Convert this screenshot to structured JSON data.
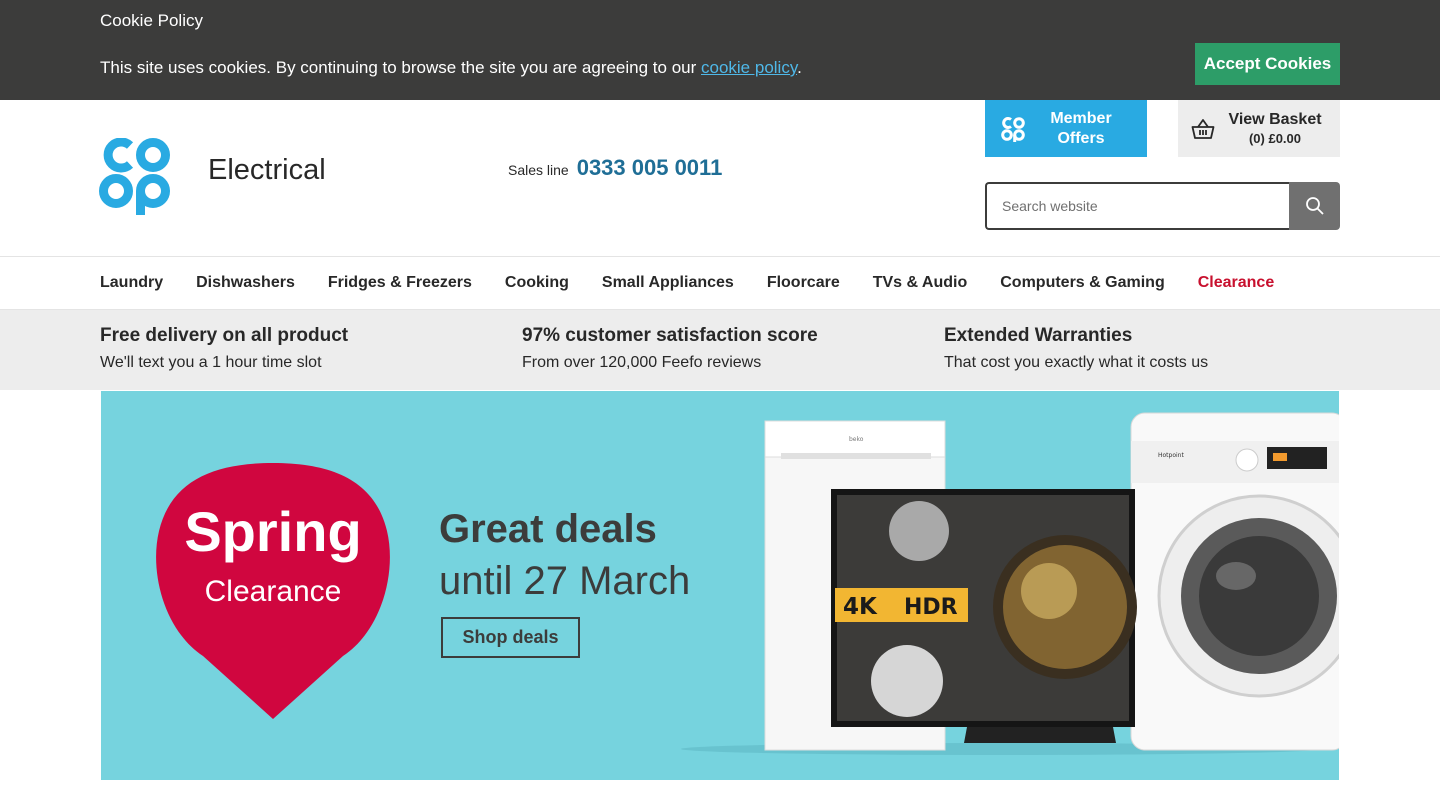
{
  "cookie": {
    "title": "Cookie Policy",
    "message": "This site uses cookies. By continuing to browse the site you are agreeing to our ",
    "link_text": "cookie policy",
    "period": ".",
    "accept_label": "Accept Cookies"
  },
  "header": {
    "logo_icon": "coop-logo-icon",
    "site_name": "Electrical",
    "sales_label": "Sales line",
    "sales_phone": "0333 005 0011",
    "member_label": "Member Offers",
    "basket_label": "View Basket",
    "basket_summary": "(0) £0.00",
    "search_placeholder": "Search website"
  },
  "nav": {
    "items": [
      "Laundry",
      "Dishwashers",
      "Fridges & Freezers",
      "Cooking",
      "Small Appliances",
      "Floorcare",
      "TVs & Audio",
      "Computers & Gaming",
      "Clearance"
    ]
  },
  "benefits": [
    {
      "title": "Free delivery on all product",
      "subtitle": "We'll text you a 1 hour time slot"
    },
    {
      "title": "97% customer satisfaction score",
      "subtitle": "From over 120,000 Feefo reviews"
    },
    {
      "title": "Extended Warranties",
      "subtitle": "That cost you exactly what it costs us"
    }
  ],
  "hero": {
    "badge_title": "Spring",
    "badge_subtitle": "Clearance",
    "headline": "Great deals",
    "subheadline": "until 27 March",
    "cta_label": "Shop deals",
    "tv_badge_4k": "4K",
    "tv_badge_hdr": "HDR",
    "fridge_brand": "beko",
    "washer_brand": "Hotpoint"
  },
  "colors": {
    "cookie_bar": "#3c3c3b",
    "accept": "#2d9d68",
    "brand_blue": "#29aae2",
    "phone_blue": "#1f6e96",
    "clearance_red": "#c8102e",
    "badge_red": "#d0063f",
    "hero_bg": "#76d3de"
  }
}
